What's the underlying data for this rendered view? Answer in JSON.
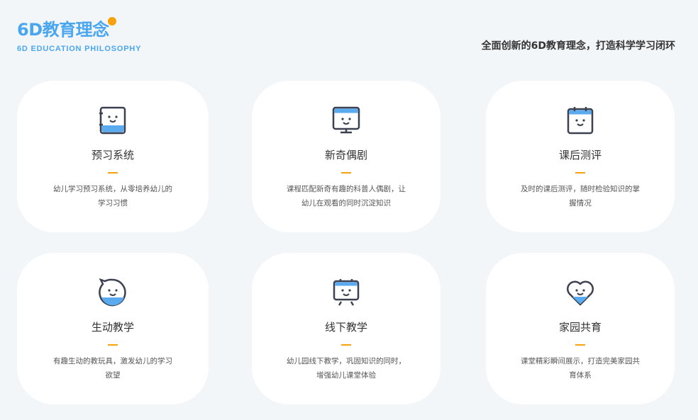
{
  "header": {
    "title": "6D教育理念",
    "subtitle": "6D EDUCATION PHILOSOPHY",
    "slogan": "全面创新的6D教育理念，打造科学学习闭环"
  },
  "colors": {
    "accent": "#4ba6f0",
    "orange": "#f7a20d",
    "icon": "#3b4150"
  },
  "cards": [
    {
      "icon": "notebook-icon",
      "title": "预习系统",
      "desc": "幼儿学习预习系统，从零培养幼儿的学习习惯"
    },
    {
      "icon": "monitor-icon",
      "title": "新奇偶剧",
      "desc": "课程匹配新奇有趣的科普人偶剧，让幼儿在观看的同时沉淀知识"
    },
    {
      "icon": "calendar-icon",
      "title": "课后测评",
      "desc": "及时的课后测评，随时检验知识的掌握情况"
    },
    {
      "icon": "chat-bubble-icon",
      "title": "生动教学",
      "desc": "有趣生动的教玩具，激发幼儿的学习欲望"
    },
    {
      "icon": "easel-icon",
      "title": "线下教学",
      "desc": "幼儿园线下教学，巩固知识的同时，增强幼儿课堂体验"
    },
    {
      "icon": "heart-icon",
      "title": "家园共育",
      "desc": "课堂精彩瞬间展示，打造完美家园共育体系"
    }
  ]
}
